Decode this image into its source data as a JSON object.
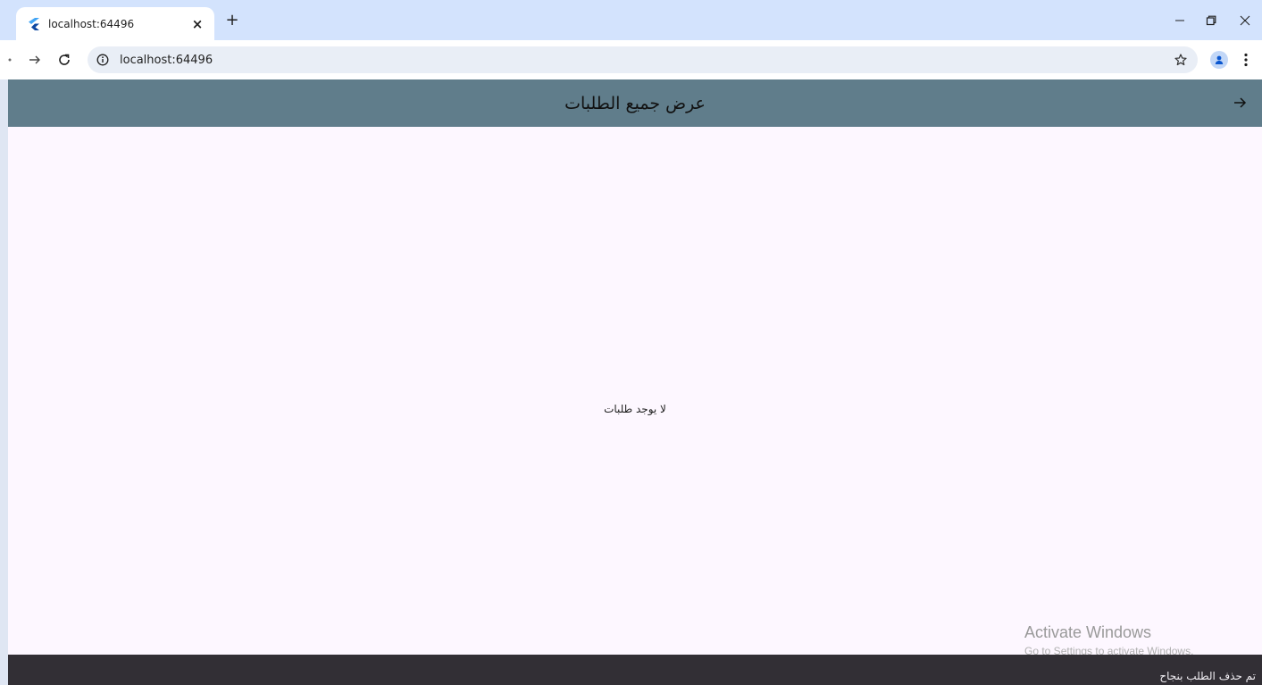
{
  "browser": {
    "tab_title": "localhost:64496",
    "tab_close": "×",
    "new_tab": "+",
    "address": "localhost:64496",
    "icons": {
      "favicon": "flutter-icon",
      "back": "back-arrow-icon",
      "forward": "forward-arrow-icon",
      "reload": "reload-icon",
      "info": "info-icon",
      "star": "star-icon",
      "profile": "profile-icon",
      "menu": "menu-dots-icon"
    },
    "colors": {
      "tabbar": "#d3e3fd",
      "toolbar": "#ffffff",
      "omnibox": "#e9eef6"
    }
  },
  "app": {
    "appbar": {
      "title": "عرض جميع الطلبات",
      "back_icon": "arrow-forward-icon",
      "color": "#607d8b"
    },
    "empty_message": "لا يوجد طلبات",
    "background": "#fdf7ff",
    "snackbar": {
      "text": "تم حذف الطلب بنجاح",
      "color": "#322f35"
    }
  },
  "watermark": {
    "title": "Activate Windows",
    "subtitle": "Go to Settings to activate Windows."
  }
}
